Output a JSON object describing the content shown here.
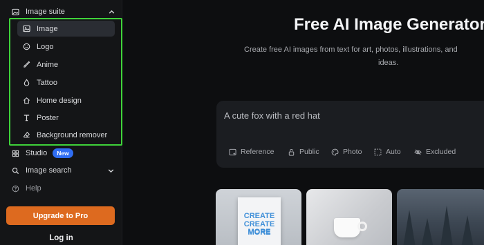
{
  "sidebar": {
    "section_title": "Image suite",
    "sub_items": [
      {
        "label": "Image",
        "icon": "image-icon",
        "active": true
      },
      {
        "label": "Logo",
        "icon": "smile-icon"
      },
      {
        "label": "Anime",
        "icon": "brush-icon"
      },
      {
        "label": "Tattoo",
        "icon": "drop-icon"
      },
      {
        "label": "Home design",
        "icon": "home-icon"
      },
      {
        "label": "Poster",
        "icon": "text-t-icon"
      },
      {
        "label": "Background remover",
        "icon": "eraser-icon"
      }
    ],
    "studio": {
      "label": "Studio",
      "badge": "New"
    },
    "image_search": {
      "label": "Image search"
    },
    "help": {
      "label": "Help"
    },
    "upgrade_label": "Upgrade to Pro",
    "login_label": "Log in"
  },
  "main": {
    "title": "Free AI Image Generator",
    "subtitle_line1": "Create free AI images from text for art, photos, illustrations, and",
    "subtitle_line2": "ideas.",
    "prompt_value": "A cute fox with a red hat",
    "options": [
      {
        "label": "Reference",
        "icon": "reference-image-icon"
      },
      {
        "label": "Public",
        "icon": "lock-icon"
      },
      {
        "label": "Photo",
        "icon": "palette-icon"
      },
      {
        "label": "Auto",
        "icon": "aspect-ratio-icon"
      },
      {
        "label": "Excluded",
        "icon": "eye-off-icon"
      }
    ],
    "thumbnails": [
      {
        "poster_lines": [
          "CREATE",
          "CREATE MORE",
          "MORE"
        ]
      },
      {
        "subject": "cup"
      },
      {
        "subject": "forest"
      }
    ]
  },
  "colors": {
    "accent_orange": "#dd6a1f",
    "highlight_green": "#3fd33a",
    "badge_blue": "#2f6df2"
  }
}
